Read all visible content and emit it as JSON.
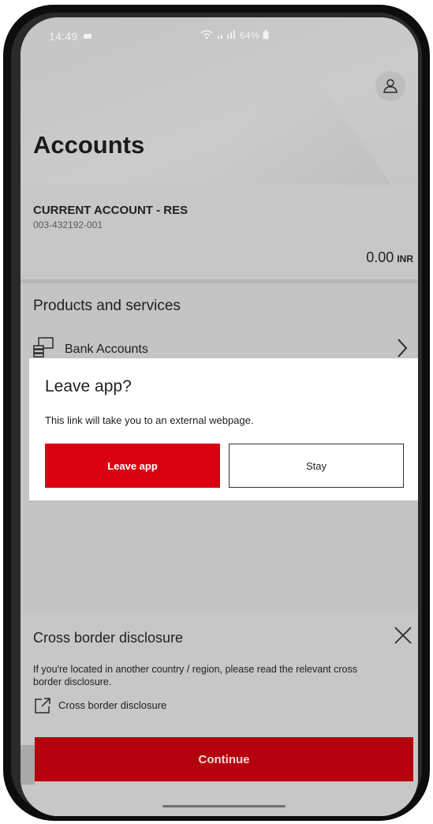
{
  "status_bar": {
    "time": "14:49",
    "right": "64%"
  },
  "header": {
    "title": "Accounts"
  },
  "account": {
    "name": "CURRENT ACCOUNT - RES",
    "number": "003-432192-001",
    "balance": "0.00",
    "currency": "INR"
  },
  "products": {
    "title": "Products and services",
    "items": [
      {
        "label": "Bank Accounts",
        "icon": "bank-accounts-icon"
      }
    ]
  },
  "modal": {
    "title": "Leave app?",
    "text": "This link will take you to an external webpage.",
    "leave_label": "Leave app",
    "stay_label": "Stay"
  },
  "cross_border": {
    "title": "Cross border disclosure",
    "text": "If you're located in another country / region, please read the relevant cross border disclosure.",
    "link_label": "Cross border disclosure",
    "continue_label": "Continue"
  },
  "colors": {
    "brand_red": "#db0011",
    "continue_red": "#b5010e",
    "overlay_gray": "#c4c4c4"
  }
}
